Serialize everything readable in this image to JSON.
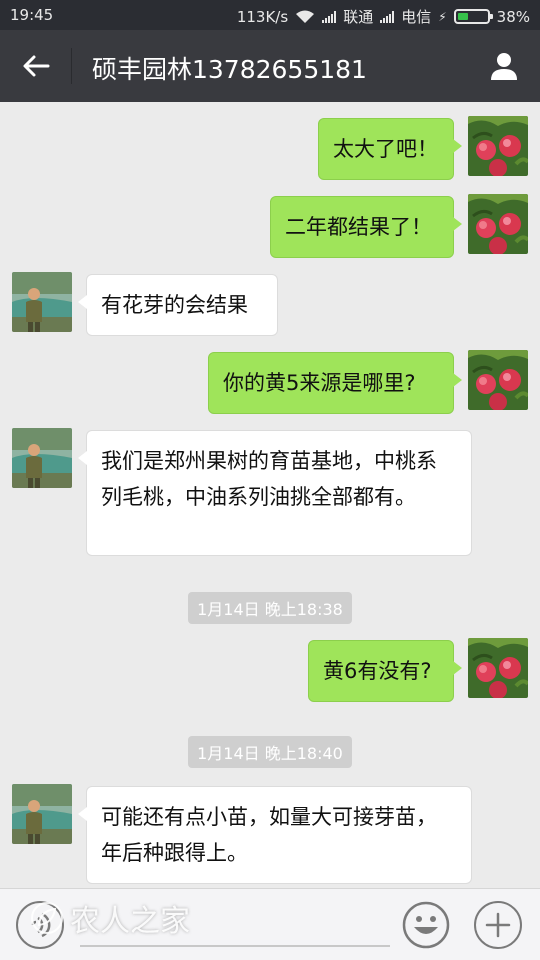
{
  "status_bar": {
    "time": "19:45",
    "speed": "113K/s",
    "carrier1": "联通",
    "carrier2": "电信",
    "battery": "38%",
    "battery_level": 0.38
  },
  "header": {
    "title": "硕丰园林13782655181"
  },
  "messages": [
    {
      "direction": "out",
      "text": "太大了吧！"
    },
    {
      "direction": "out",
      "text": "二年都结果了！"
    },
    {
      "direction": "in",
      "text": "有花芽的会结果"
    },
    {
      "direction": "out",
      "text": "你的黄5来源是哪里?"
    },
    {
      "direction": "in",
      "text": "我们是郑州果树的育苗基地，中桃系列毛桃，中油系列油挑全部都有。"
    },
    {
      "timestamp": "1月14日 晚上18:38"
    },
    {
      "direction": "out",
      "text": "黄6有没有?"
    },
    {
      "timestamp": "1月14日 晚上18:40"
    },
    {
      "direction": "in",
      "text": "可能还有点小苗，如量大可接芽苗，年后种跟得上。"
    }
  ],
  "input_bar": {
    "voice_icon": "voice-icon",
    "emoji_icon": "emoji-icon",
    "plus_icon": "plus-icon",
    "watermark": "农人之家"
  },
  "colors": {
    "status_bar_bg": "#2b2d33",
    "title_bar_bg": "#393a3f",
    "chat_bg": "#ebebeb",
    "outgoing_bubble": "#9fe45a",
    "incoming_bubble": "#ffffff"
  }
}
